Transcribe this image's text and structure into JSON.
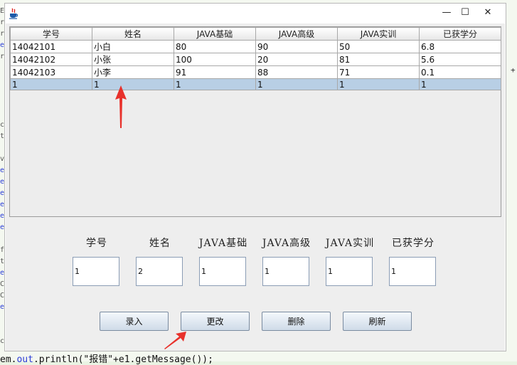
{
  "background": {
    "gutter_chars": [
      "E",
      "r",
      "r",
      "e",
      "r",
      "",
      "",
      "",
      "",
      "",
      "c",
      "t",
      "",
      "v",
      "e",
      "e",
      "e",
      "e",
      "e",
      "e",
      "",
      "f",
      "t",
      "e",
      "C",
      "C",
      "e",
      "",
      "",
      "c"
    ],
    "bottom_code": {
      "obj": "em.",
      "field": "out",
      "call": ".println(\"报错\"+e1.getMessage());"
    },
    "right_marker": "+"
  },
  "window": {
    "controls": {
      "minimize": "—",
      "maximize": "☐",
      "close": "✕"
    }
  },
  "table": {
    "columns": [
      "学号",
      "姓名",
      "JAVA基础",
      "JAVA高级",
      "JAVA实训",
      "已获学分"
    ],
    "rows": [
      [
        "14042101",
        "小白",
        "80",
        "90",
        "50",
        "6.8"
      ],
      [
        "14042102",
        "小张",
        "100",
        "20",
        "81",
        "5.6"
      ],
      [
        "14042103",
        "小李",
        "91",
        "88",
        "71",
        "0.1"
      ],
      [
        "1",
        "1",
        "1",
        "1",
        "1",
        "1"
      ]
    ],
    "selected_row": 3
  },
  "form": {
    "labels": [
      "学号",
      "姓名",
      "JAVA基础",
      "JAVA高级",
      "JAVA实训",
      "已获学分"
    ],
    "values": [
      "1",
      "2",
      "1",
      "1",
      "1",
      "1"
    ]
  },
  "buttons": {
    "insert": "录入",
    "update": "更改",
    "delete": "删除",
    "refresh": "刷新"
  },
  "colors": {
    "arrow": "#e8312b",
    "selection": "#b8cfe5",
    "accent_code": "#2a3bd6"
  }
}
